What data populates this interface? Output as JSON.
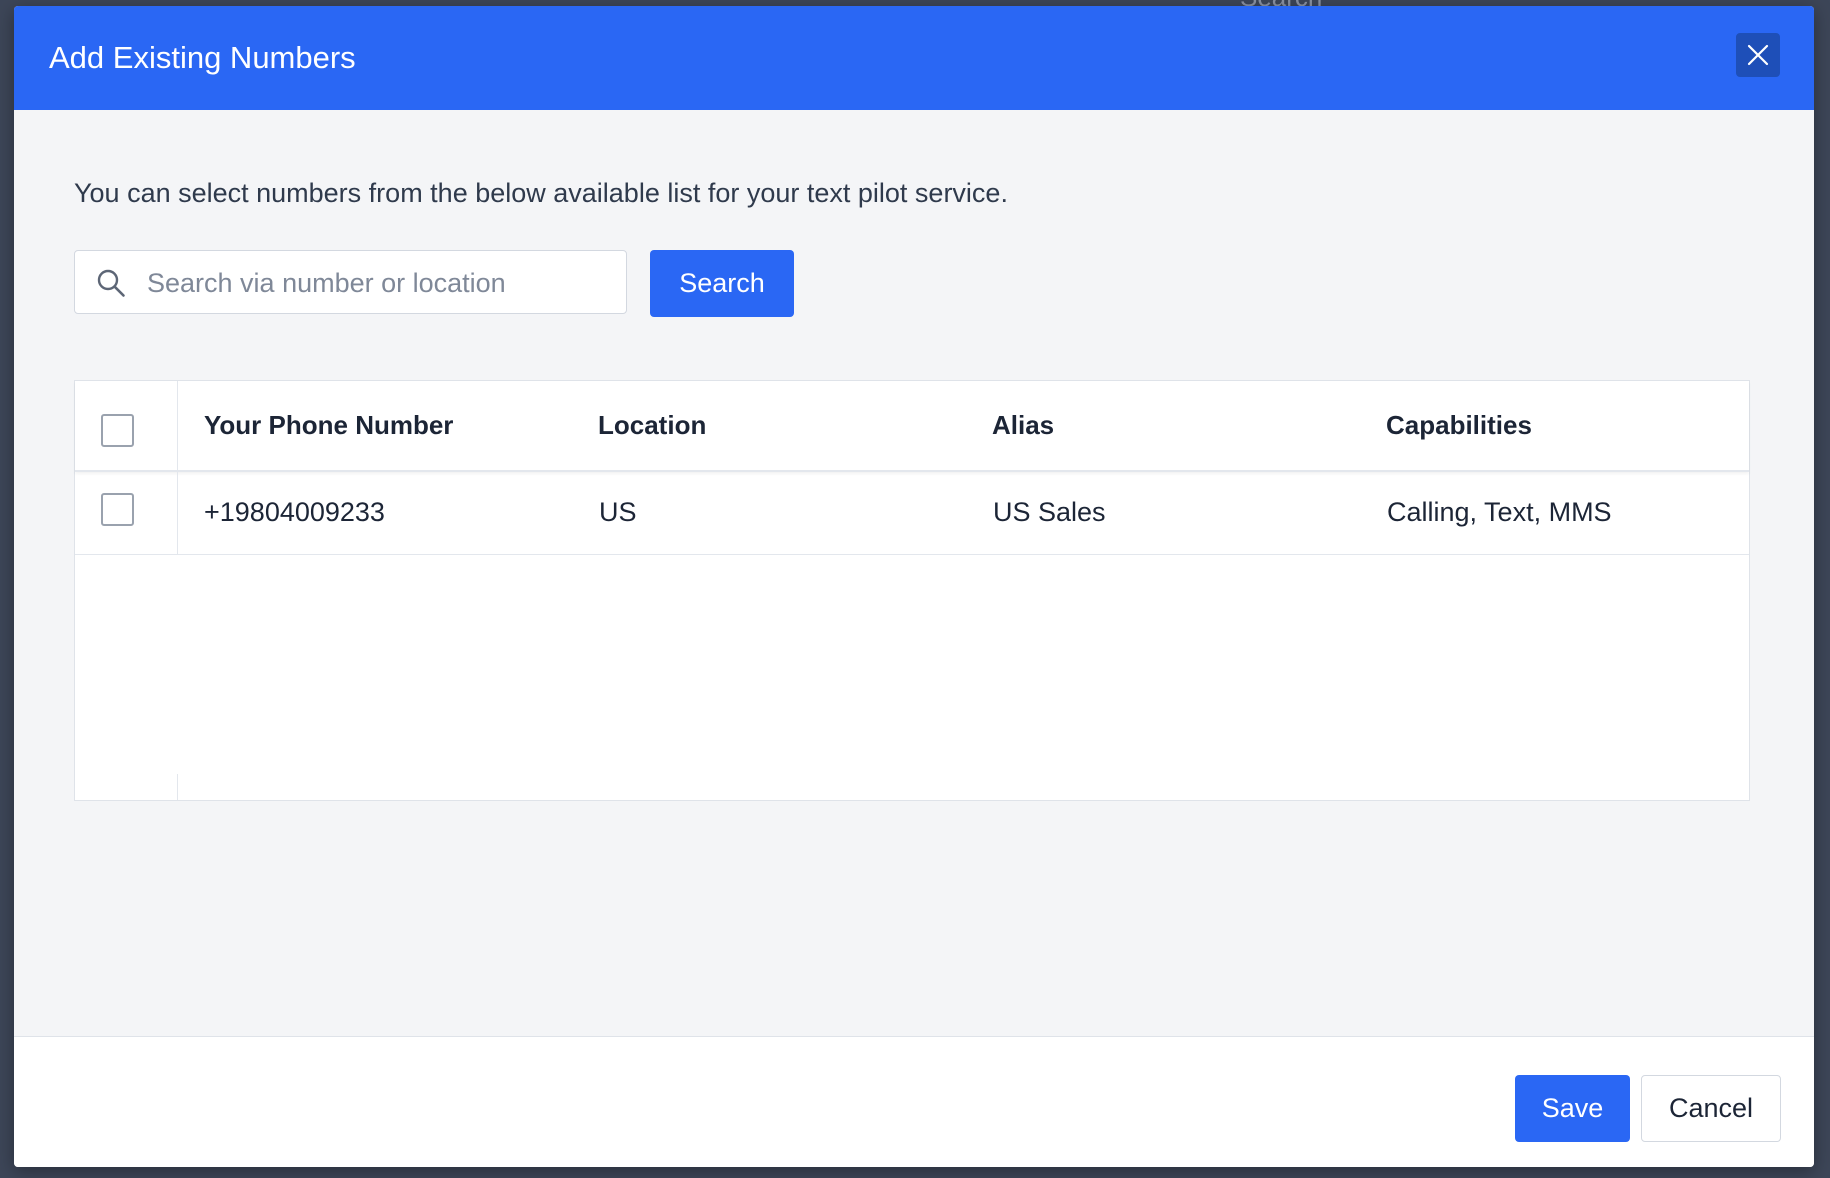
{
  "backdrop": {
    "search_label": "Search"
  },
  "modal": {
    "title": "Add Existing Numbers",
    "intro": "You can select numbers from the below available list for your text pilot service.",
    "search": {
      "placeholder": "Search via number or location",
      "value": "",
      "button_label": "Search"
    },
    "table": {
      "columns": [
        "Your Phone Number",
        "Location",
        "Alias",
        "Capabilities"
      ],
      "rows": [
        {
          "checked": false,
          "phone": "+19804009233",
          "location": "US",
          "alias": "US Sales",
          "capabilities": "Calling, Text, MMS"
        }
      ]
    },
    "footer": {
      "save_label": "Save",
      "cancel_label": "Cancel"
    }
  },
  "colors": {
    "accent": "#2a67f4",
    "close_button_bg": "#1e4fb8",
    "modal_bg": "#f4f5f7",
    "backdrop": "#3d4658"
  },
  "icons": {
    "close": "close-icon",
    "search": "search-icon"
  }
}
